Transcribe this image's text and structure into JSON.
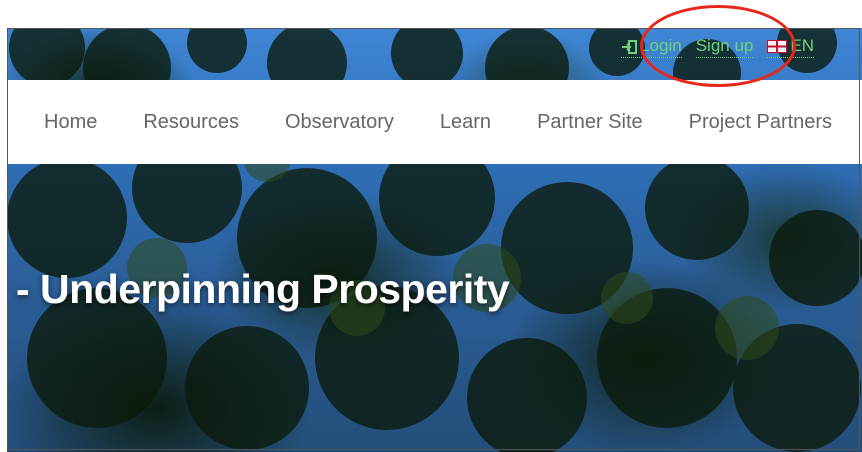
{
  "utility": {
    "login_label": "Login",
    "signup_label": "Sign up",
    "language_label": "EN",
    "login_icon": "sign-in-icon",
    "language_icon": "uk-flag-icon",
    "link_color": "#6fd07a"
  },
  "nav": {
    "items": [
      {
        "label": "Home"
      },
      {
        "label": "Resources"
      },
      {
        "label": "Observatory"
      },
      {
        "label": "Learn"
      },
      {
        "label": "Partner Site"
      },
      {
        "label": "Project Partners"
      }
    ]
  },
  "hero": {
    "title": "- Underpinning Prosperity"
  },
  "annotation": {
    "color": "#e8271b"
  }
}
